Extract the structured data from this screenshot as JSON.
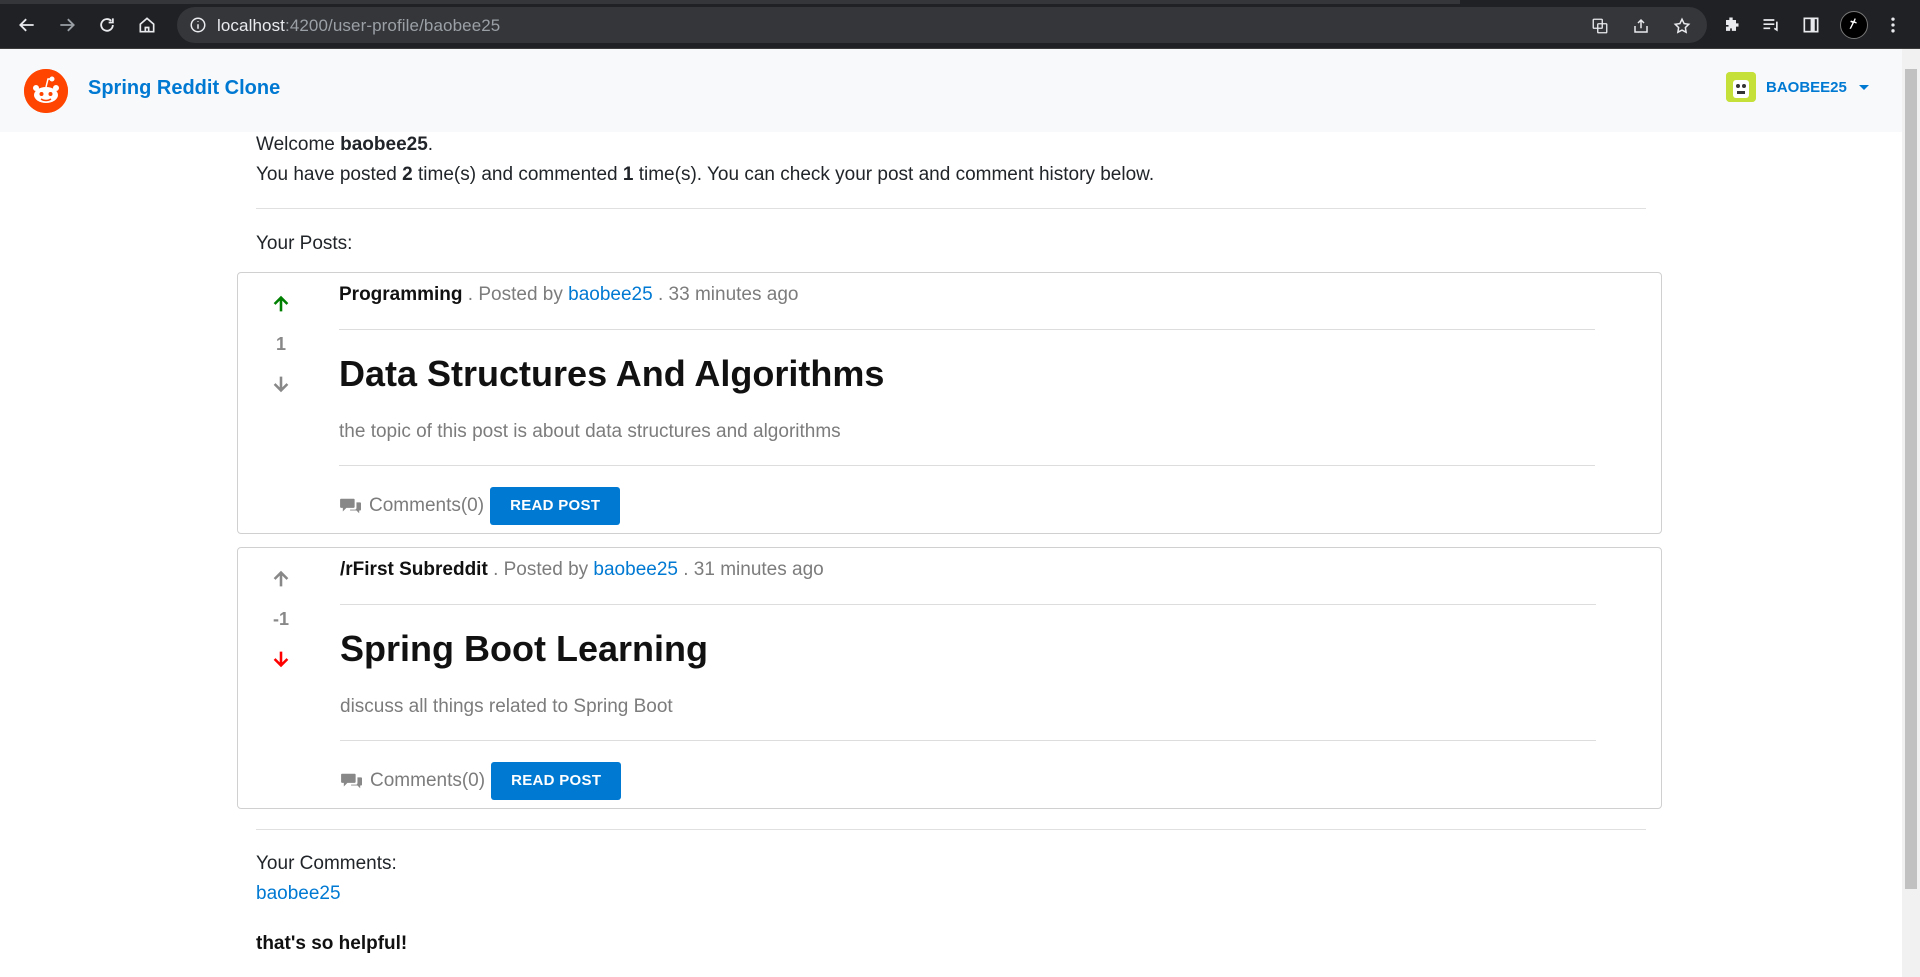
{
  "browser": {
    "url_host": "localhost",
    "url_path": ":4200/user-profile/baobee25"
  },
  "header": {
    "brand": "Spring Reddit Clone",
    "username": "BAOBEE25"
  },
  "profile": {
    "welcome_prefix": "Welcome ",
    "username": "baobee25",
    "welcome_suffix": ".",
    "stats_prefix": "You have posted ",
    "post_count": "2",
    "stats_middle": " time(s) and commented ",
    "comment_count": "1",
    "stats_suffix": " time(s). You can check your post and comment history below."
  },
  "posts_label": "Your Posts:",
  "posts": [
    {
      "subreddit": "Programming",
      "posted_by_text": " . Posted by ",
      "author": "baobee25",
      "time": " . 33 minutes ago",
      "votes": "1",
      "vote_state": "up",
      "title": "Data Structures And Algorithms",
      "description": "the topic of this post is about data structures and algorithms",
      "comments": "Comments(0)",
      "read_label": "READ POST"
    },
    {
      "subreddit": "/rFirst Subreddit",
      "posted_by_text": " . Posted by ",
      "author": "baobee25",
      "time": " . 31 minutes ago",
      "votes": "-1",
      "vote_state": "down",
      "title": "Spring Boot Learning",
      "description": "discuss all things related to Spring Boot",
      "comments": "Comments(0)",
      "read_label": "READ POST"
    }
  ],
  "comments_label": "Your Comments:",
  "comments": [
    {
      "author": "baobee25",
      "text": "that's so helpful!"
    }
  ],
  "colors": {
    "accent": "#0079d3",
    "upvote_active": "#008000",
    "downvote_active": "#ff0000",
    "brand_orange": "#ff4500"
  }
}
